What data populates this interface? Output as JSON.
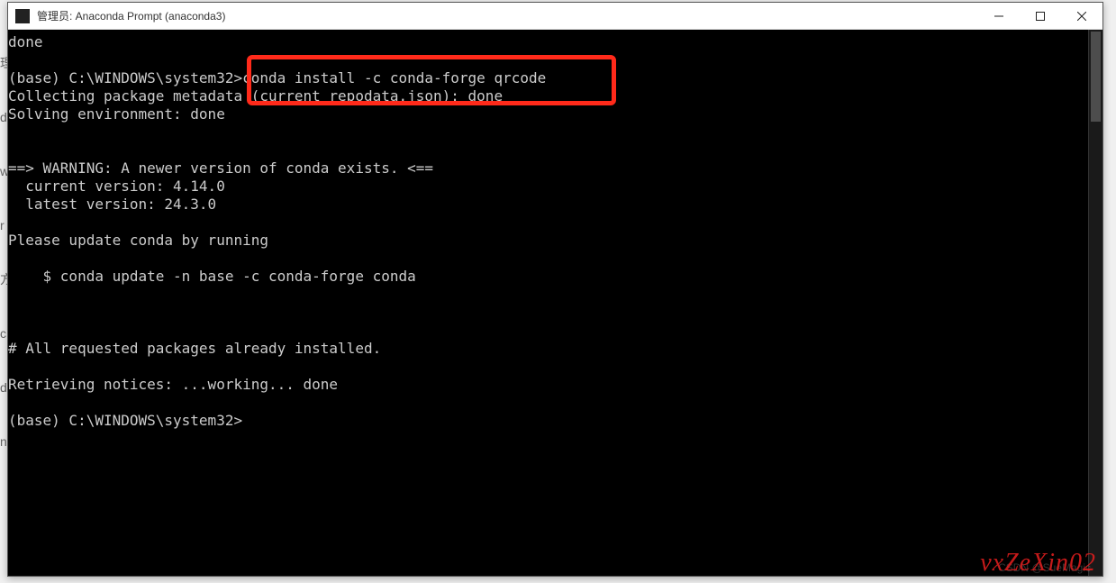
{
  "window": {
    "title": "管理员: Anaconda Prompt (anaconda3)"
  },
  "terminal": {
    "lines": [
      "done",
      "",
      "(base) C:\\WINDOWS\\system32>conda install -c conda-forge qrcode",
      "Collecting package metadata (current_repodata.json): done",
      "Solving environment: done",
      "",
      "",
      "==> WARNING: A newer version of conda exists. <==",
      "  current version: 4.14.0",
      "  latest version: 24.3.0",
      "",
      "Please update conda by running",
      "",
      "    $ conda update -n base -c conda-forge conda",
      "",
      "",
      "",
      "# All requested packages already installed.",
      "",
      "Retrieving notices: ...working... done",
      "",
      "(base) C:\\WINDOWS\\system32>"
    ]
  },
  "behind_fragments": [
    "理",
    "d",
    "w",
    "r",
    "方",
    "c",
    "d",
    "n"
  ],
  "watermarks": {
    "main": "vxZeXin02",
    "small": "CSDN @SueMagic"
  }
}
